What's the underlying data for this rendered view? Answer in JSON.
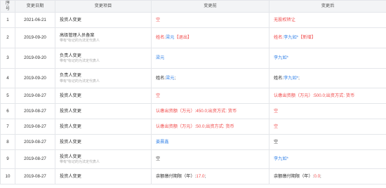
{
  "table": {
    "headers": {
      "seq": "序号",
      "date": "变更日期",
      "item": "变更项目",
      "before": "变更前",
      "after": "变更后"
    },
    "rows": [
      {
        "seq": "1",
        "date": "2021-06-21",
        "item": "投资人变更",
        "item_note": "",
        "before": [
          {
            "text": "空",
            "color": "#f04b4b"
          }
        ],
        "after": [
          {
            "text": "无股权转让",
            "color": "#f04b4b"
          }
        ]
      },
      {
        "seq": "2",
        "date": "2019-09-20",
        "item": "高级管理人员备案",
        "item_note": "带有*标记的为法定代表人",
        "before": [
          {
            "text": "姓名:",
            "color": "#f04b4b"
          },
          {
            "text": "梁元",
            "color": "#3a86e8"
          },
          {
            "text": "【退出】",
            "color": "#f04b4b"
          }
        ],
        "after": [
          {
            "text": "姓名:",
            "color": "#f04b4b"
          },
          {
            "text": "李九如*",
            "color": "#3a86e8"
          },
          {
            "text": "【新增】",
            "color": "#f04b4b"
          }
        ]
      },
      {
        "seq": "3",
        "date": "2019-09-20",
        "item": "负责人变更",
        "item_note": "带有*标记的为法定代表人",
        "before": [
          {
            "text": "梁元",
            "color": "#3a86e8"
          }
        ],
        "after": [
          {
            "text": "李九如*",
            "color": "#3a86e8"
          }
        ]
      },
      {
        "seq": "4",
        "date": "2019-09-20",
        "item": "负责人变更",
        "item_note": "带有*标记的为法定代表人",
        "before": [
          {
            "text": "姓名:",
            "color": "#333333"
          },
          {
            "text": "梁元",
            "color": "#3a86e8"
          },
          {
            "text": ";",
            "color": "#333333"
          }
        ],
        "after": [
          {
            "text": "姓名:",
            "color": "#333333"
          },
          {
            "text": "李九如*",
            "color": "#3a86e8"
          },
          {
            "text": ";",
            "color": "#333333"
          }
        ]
      },
      {
        "seq": "5",
        "date": "2019-08-27",
        "item": "投资人变更",
        "item_note": "",
        "before": [
          {
            "text": "空",
            "color": "#f04b4b"
          }
        ],
        "after": [
          {
            "text": "认缴出资额（万元）:500.0;出资方式: 货币",
            "color": "#f04b4b"
          }
        ]
      },
      {
        "seq": "6",
        "date": "2019-08-27",
        "item": "投资人变更",
        "item_note": "",
        "before": [
          {
            "text": "认缴出资额（万元）:450.0;出资方式: 货币",
            "color": "#f04b4b"
          }
        ],
        "after": [
          {
            "text": "空",
            "color": "#f04b4b"
          }
        ]
      },
      {
        "seq": "7",
        "date": "2019-08-27",
        "item": "投资人变更",
        "item_note": "",
        "before": [
          {
            "text": "认缴出资额（万元）:50.0;出资方式: 货币",
            "color": "#f04b4b"
          }
        ],
        "after": [
          {
            "text": "空",
            "color": "#f04b4b"
          }
        ]
      },
      {
        "seq": "8",
        "date": "2019-08-27",
        "item": "投资人变更",
        "item_note": "",
        "before": [
          {
            "text": "姜晨鑫",
            "color": "#3a86e8"
          }
        ],
        "after": [
          {
            "text": "空",
            "color": "#333333"
          }
        ]
      },
      {
        "seq": "9",
        "date": "2019-08-27",
        "item": "投资人变更",
        "item_note": "带有*标记的为法定代表人",
        "before": [
          {
            "text": "空",
            "color": "#333333"
          }
        ],
        "after": [
          {
            "text": "李九如*",
            "color": "#3a86e8"
          }
        ]
      },
      {
        "seq": "10",
        "date": "2019-08-27",
        "item": "投资人变更",
        "item_note": "",
        "before": [
          {
            "text": "余额缴付期限（年）:",
            "color": "#333333"
          },
          {
            "text": "17.0",
            "color": "#f04b4b"
          },
          {
            "text": ";",
            "color": "#333333"
          }
        ],
        "after": [
          {
            "text": "余额缴付期限（年）:",
            "color": "#333333"
          },
          {
            "text": "0.0",
            "color": "#f04b4b"
          },
          {
            "text": ";",
            "color": "#333333"
          }
        ]
      }
    ]
  }
}
